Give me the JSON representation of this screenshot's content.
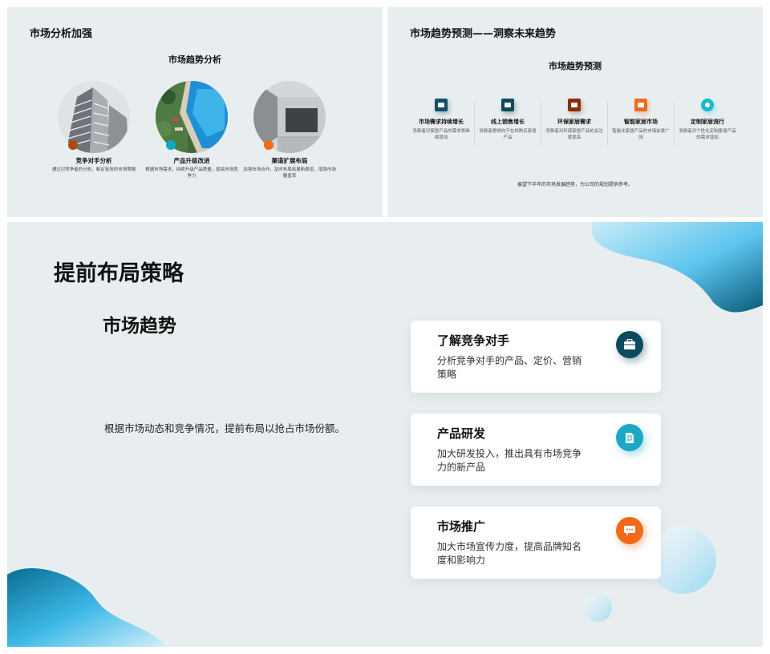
{
  "slide1": {
    "title": "市场分析加强",
    "subtitle": "市场趋势分析",
    "items": [
      {
        "title": "竞争对手分析",
        "desc": "通过对竞争者的分析，制定有效的市场策略"
      },
      {
        "title": "产品升级改进",
        "desc": "根据市场需求，持续升级产品质量，提高市场竞争力"
      },
      {
        "title": "渠道扩展布局",
        "desc": "加强市场合作，及时布局拓展新渠道，增强市场覆盖率"
      }
    ],
    "dot_colors": [
      "#b04a12",
      "#12a8c8",
      "#f06a1a"
    ]
  },
  "slide2": {
    "title": "市场趋势预测——洞察未来趋势",
    "subtitle": "市场趋势预测",
    "items": [
      {
        "title": "市场需求持续增长",
        "desc": "消费者对家居产品的需求将继续增加",
        "color": "#12506a"
      },
      {
        "title": "线上销售增长",
        "desc": "消费者更倾向于在线购买家居产品",
        "color": "#0e4a5e"
      },
      {
        "title": "环保家居需求",
        "desc": "消费者对环保家居产品的关注度提高",
        "color": "#8a2e0a"
      },
      {
        "title": "智能家居市场",
        "desc": "智能化家居产品的市场前景广阔",
        "color": "#f06a1a"
      },
      {
        "title": "定制家居流行",
        "desc": "消费者对个性化定制家居产品的需求增加",
        "color": "#18b8d6"
      }
    ],
    "footer": "展望下半年的市场发展趋势，为公司的规划提供参考。"
  },
  "slide3": {
    "title": "提前布局策略",
    "subtitle": "市场趋势",
    "body": "根据市场动态和竞争情况，提前布局以抢占市场份额。",
    "cards": [
      {
        "title": "了解竞争对手",
        "desc": "分析竞争对手的产品、定价、营销策略",
        "icon": "briefcase-icon",
        "color": "#0e4a5e"
      },
      {
        "title": "产品研发",
        "desc": "加大研发投入，推出具有市场竞争力的新产品",
        "icon": "document-icon",
        "color": "#1aa8c4"
      },
      {
        "title": "市场推广",
        "desc": "加大市场宣传力度，提高品牌知名度和影响力",
        "icon": "chat-icon",
        "color": "#f06a1a"
      }
    ]
  }
}
